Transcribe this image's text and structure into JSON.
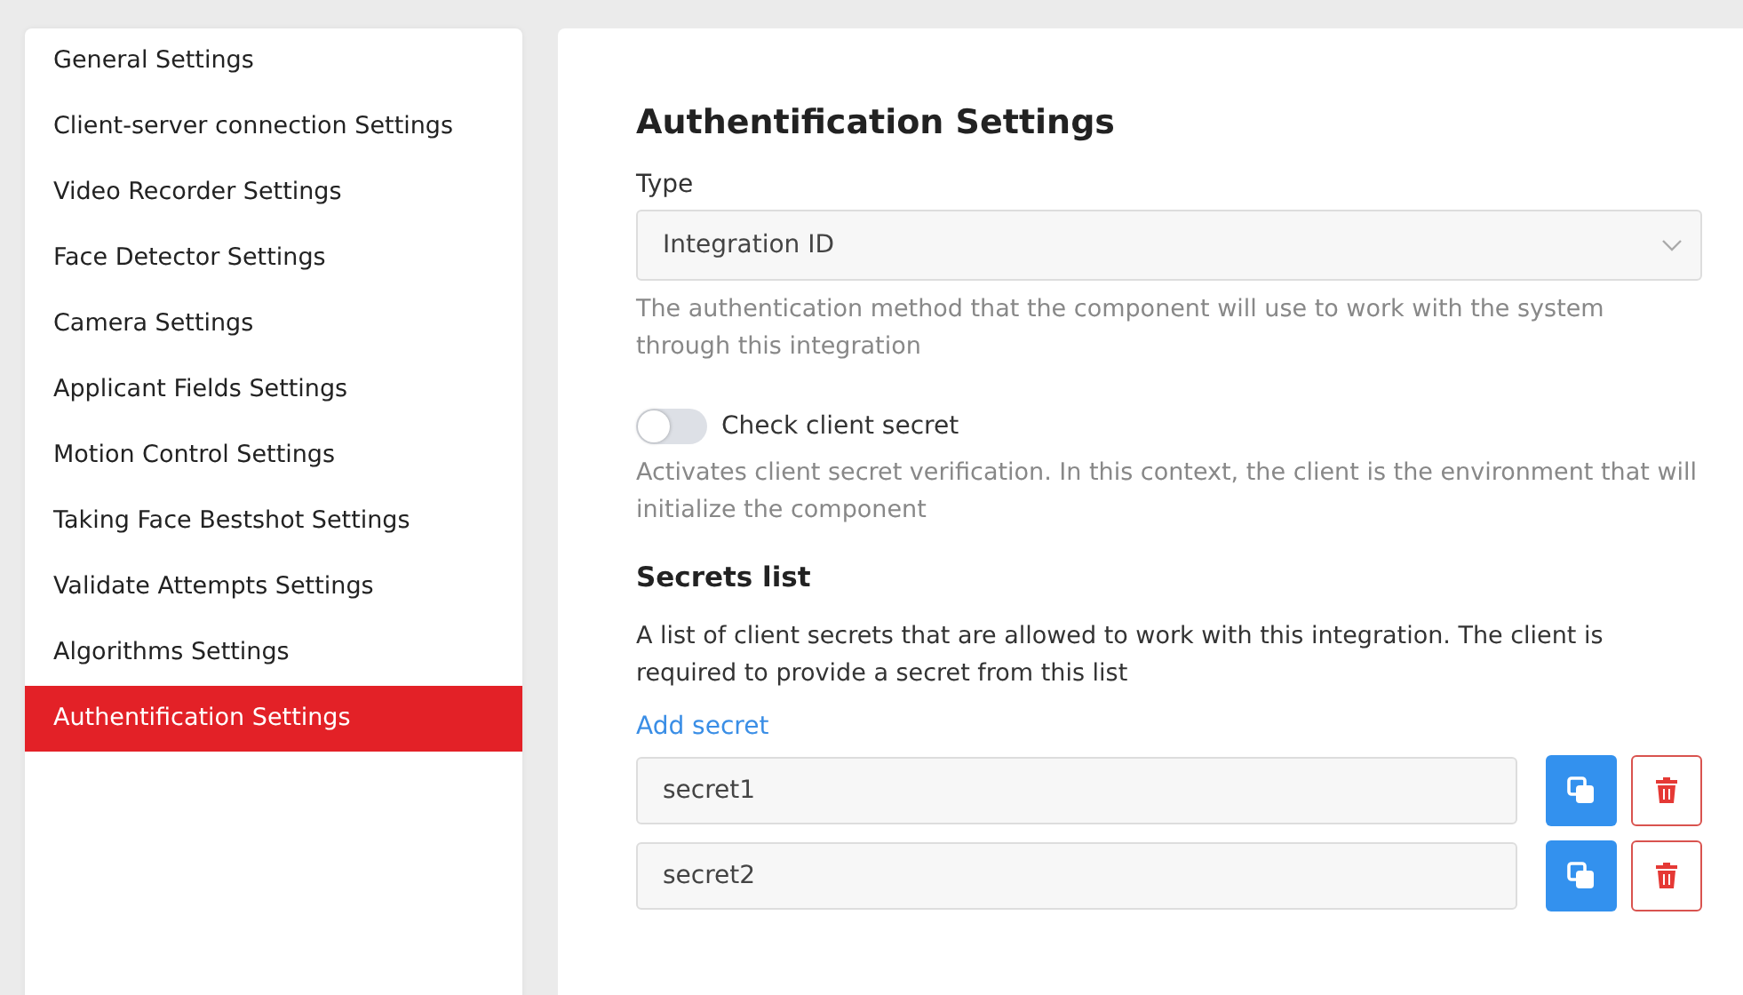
{
  "sidebar": {
    "items": [
      {
        "label": "General Settings",
        "selected": false
      },
      {
        "label": "Client-server connection Settings",
        "selected": false
      },
      {
        "label": "Video Recorder Settings",
        "selected": false
      },
      {
        "label": "Face Detector Settings",
        "selected": false
      },
      {
        "label": "Camera Settings",
        "selected": false
      },
      {
        "label": "Applicant Fields Settings",
        "selected": false
      },
      {
        "label": "Motion Control Settings",
        "selected": false
      },
      {
        "label": "Taking Face Bestshot Settings",
        "selected": false
      },
      {
        "label": "Validate Attempts Settings",
        "selected": false
      },
      {
        "label": "Algorithms Settings",
        "selected": false
      },
      {
        "label": "Authentification Settings",
        "selected": true
      }
    ]
  },
  "main": {
    "title": "Authentification Settings",
    "type_field": {
      "label": "Type",
      "value": "Integration ID",
      "hint": "The authentication method that the component will use to work with the system through this integration"
    },
    "check_secret": {
      "label": "Check client secret",
      "on": false,
      "hint": "Activates client secret verification. In this context, the client is the environment that will initialize the component"
    },
    "secrets": {
      "title": "Secrets list",
      "description": "A list of client secrets that are allowed to work with this integration. The client is required to provide a secret from this list",
      "add_link": "Add secret",
      "items": [
        {
          "value": "secret1"
        },
        {
          "value": "secret2"
        }
      ]
    }
  }
}
